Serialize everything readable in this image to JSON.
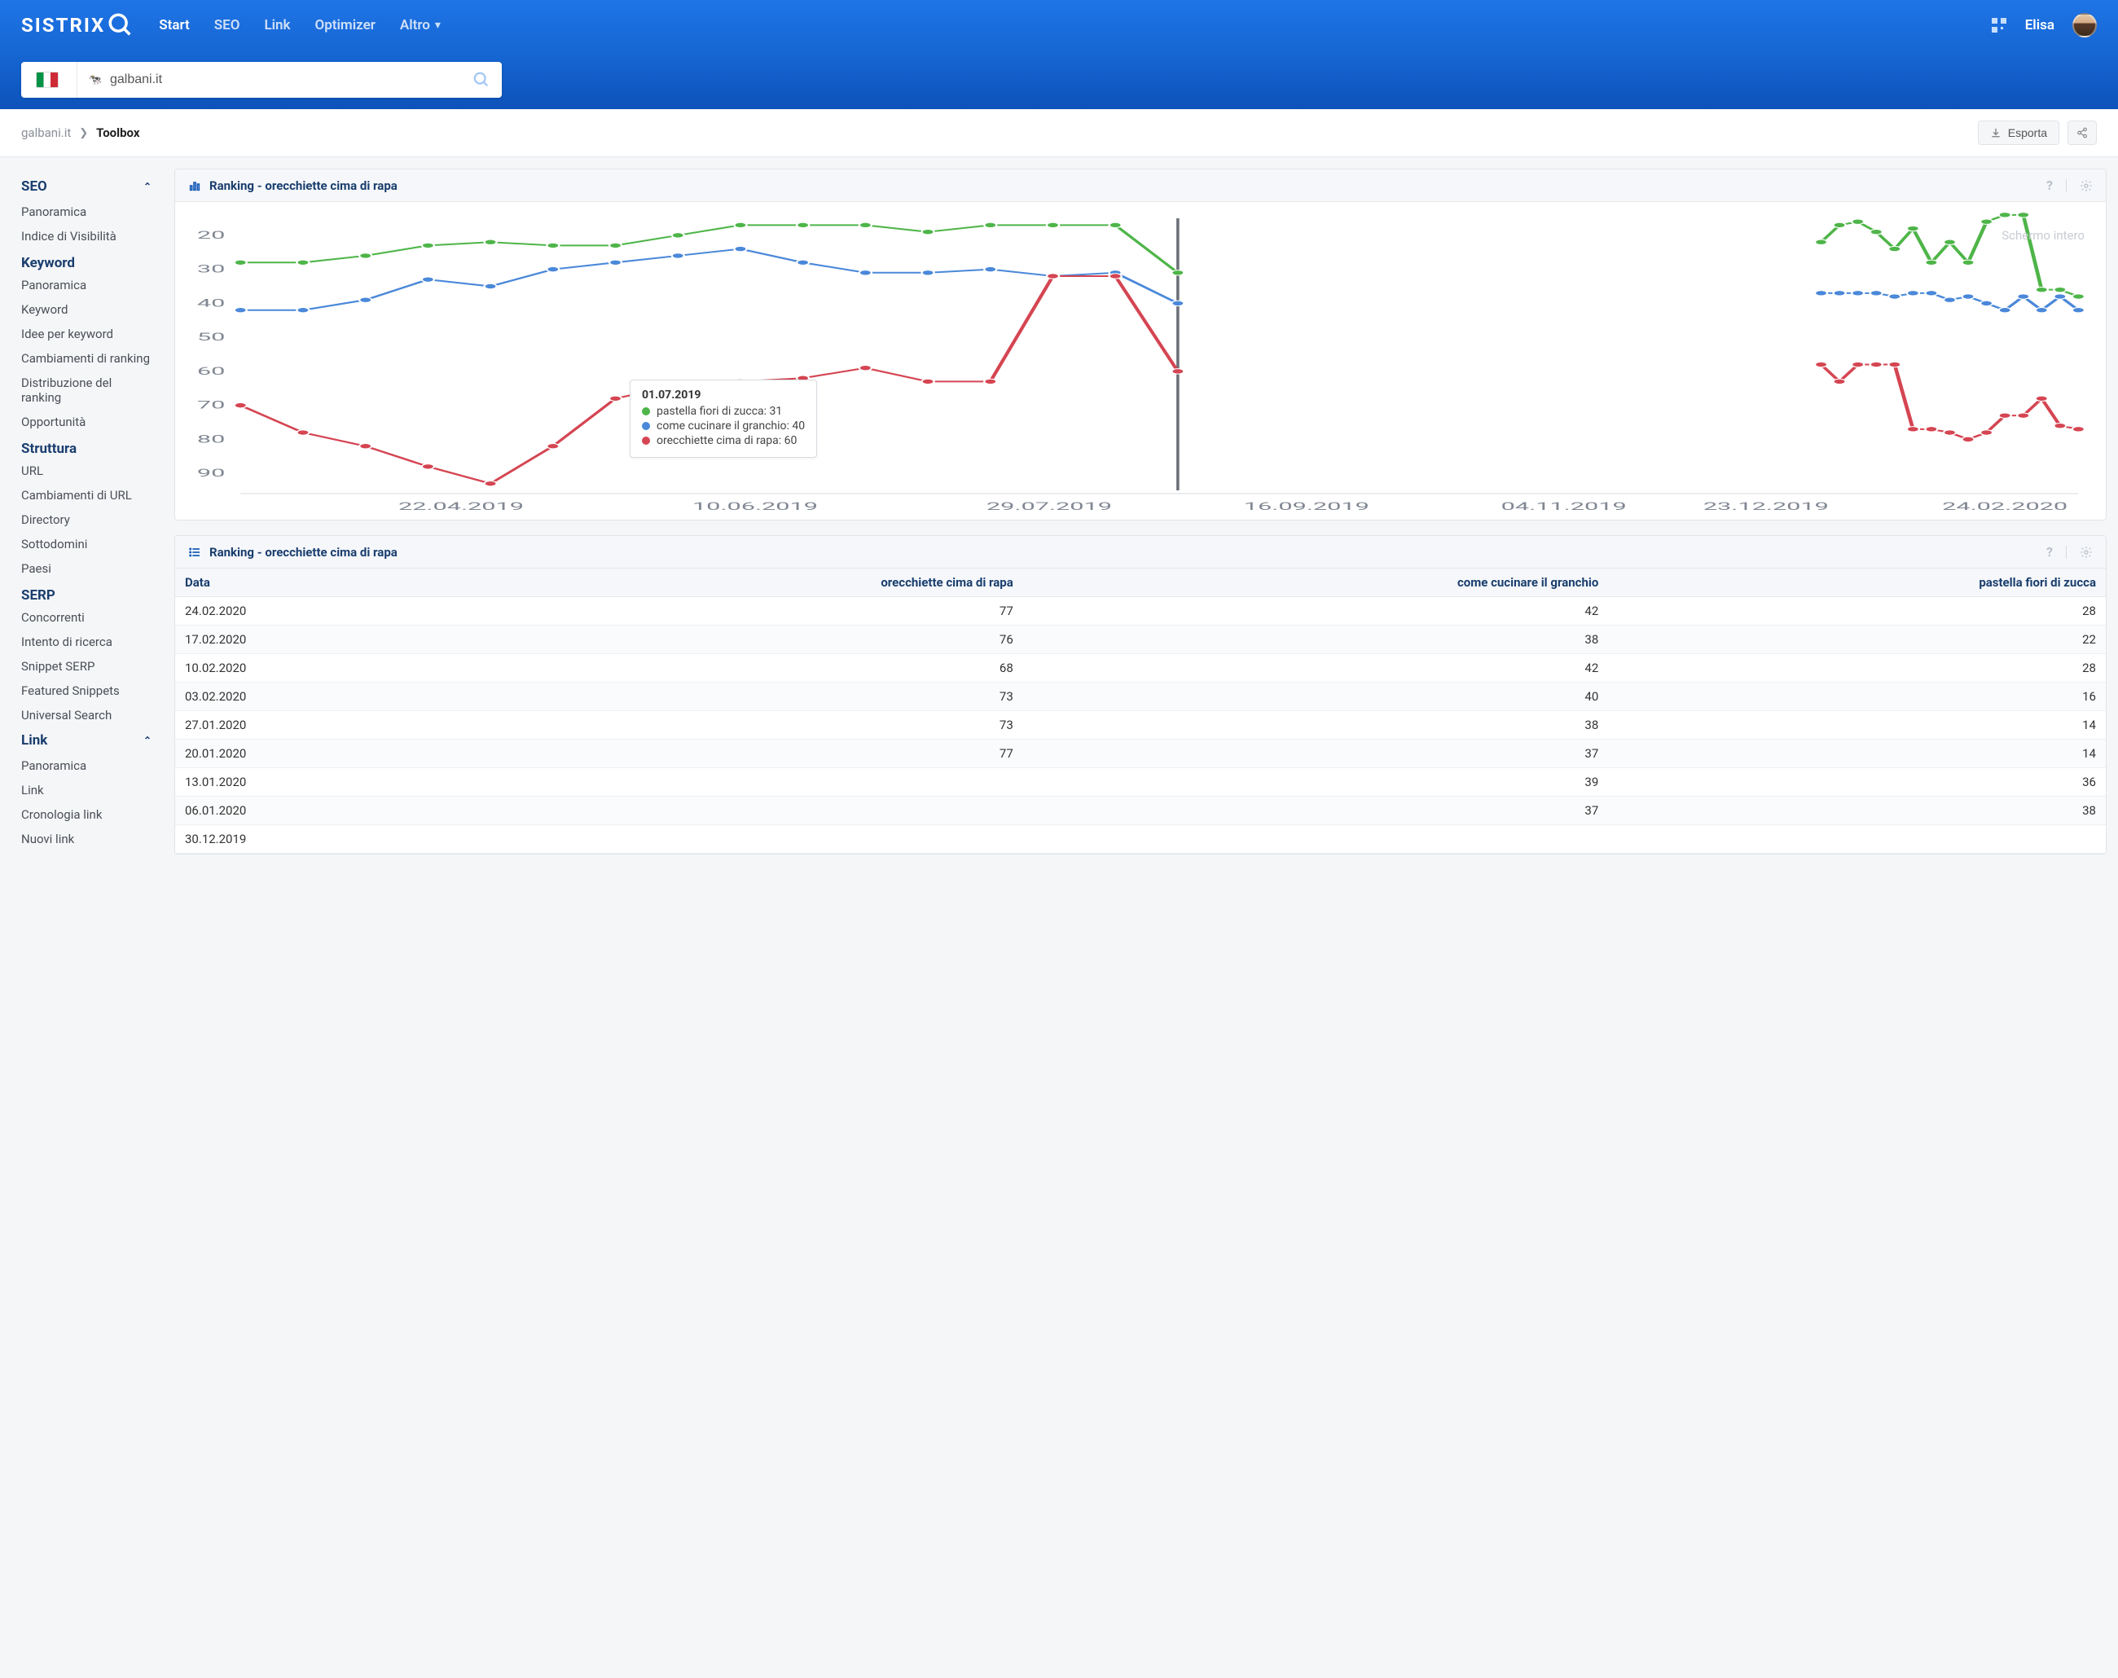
{
  "nav": {
    "brand": "SISTRIX",
    "items": [
      "Start",
      "SEO",
      "Link",
      "Optimizer",
      "Altro"
    ],
    "active": 0,
    "user": "Elisa"
  },
  "search": {
    "value": "galbani.it"
  },
  "breadcrumb": {
    "root": "galbani.it",
    "current": "Toolbox",
    "export": "Esporta"
  },
  "sidebar": {
    "sections": [
      {
        "title": "SEO",
        "collapsible": true,
        "groups": [
          {
            "items": [
              "Panoramica",
              "Indice di Visibilità"
            ]
          },
          {
            "heading": "Keyword",
            "items": [
              "Panoramica",
              "Keyword",
              "Idee per keyword",
              "Cambiamenti di ranking",
              "Distribuzione del ranking",
              "Opportunità"
            ]
          },
          {
            "heading": "Struttura",
            "items": [
              "URL",
              "Cambiamenti di URL",
              "Directory",
              "Sottodomini",
              "Paesi"
            ]
          },
          {
            "heading": "SERP",
            "items": [
              "Concorrenti",
              "Intento di ricerca",
              "Snippet SERP",
              "Featured Snippets",
              "Universal Search"
            ]
          }
        ]
      },
      {
        "title": "Link",
        "collapsible": true,
        "groups": [
          {
            "items": [
              "Panoramica",
              "Link",
              "Cronologia link",
              "Nuovi link"
            ]
          }
        ]
      }
    ]
  },
  "chart": {
    "title": "Ranking - orecchiette cima di rapa",
    "fullscreen_label": "Schermo intero",
    "tooltip": {
      "date": "01.07.2019",
      "rows": [
        {
          "label": "pastella fiori di zucca",
          "value": 31,
          "color": "#4eb548"
        },
        {
          "label": "come cucinare il granchio",
          "value": 40,
          "color": "#4a88d9"
        },
        {
          "label": "orecchiette cima di rapa",
          "value": 60,
          "color": "#d54552"
        }
      ]
    }
  },
  "chart_data": {
    "type": "line",
    "ylabel": "",
    "xlabel": "",
    "ylim": [
      95,
      15
    ],
    "x_ticks": [
      "22.04.2019",
      "10.06.2019",
      "29.07.2019",
      "16.09.2019",
      "04.11.2019",
      "23.12.2019",
      "24.02.2020"
    ],
    "y_ticks": [
      20,
      30,
      40,
      50,
      60,
      70,
      80,
      90
    ],
    "hover_index": 15,
    "break_after_index": 15,
    "break_span_weeks": 30,
    "series": [
      {
        "name": "pastella fiori di zucca",
        "color": "#4eb548",
        "values": [
          28,
          28,
          26,
          23,
          22,
          23,
          23,
          20,
          17,
          17,
          17,
          19,
          17,
          17,
          17,
          31,
          22,
          17,
          16,
          19,
          24,
          18,
          28,
          22,
          28,
          16,
          14,
          14,
          36,
          36,
          38
        ]
      },
      {
        "name": "come cucinare il granchio",
        "color": "#4a88d9",
        "values": [
          42,
          42,
          39,
          33,
          35,
          30,
          28,
          26,
          24,
          28,
          31,
          31,
          30,
          32,
          31,
          40,
          37,
          37,
          37,
          37,
          38,
          37,
          37,
          39,
          38,
          40,
          42,
          38,
          42,
          38,
          42
        ]
      },
      {
        "name": "orecchiette cima di rapa",
        "color": "#d54552",
        "values": [
          70,
          78,
          82,
          88,
          93,
          82,
          68,
          64,
          63,
          62,
          59,
          63,
          63,
          32,
          32,
          60,
          58,
          63,
          58,
          58,
          58,
          77,
          77,
          78,
          80,
          78,
          73,
          73,
          68,
          76,
          77
        ]
      }
    ]
  },
  "table": {
    "title": "Ranking - orecchiette cima di rapa",
    "columns": [
      "Data",
      "orecchiette cima di rapa",
      "come cucinare il granchio",
      "pastella fiori di zucca"
    ],
    "rows": [
      [
        "24.02.2020",
        "77",
        "42",
        "28"
      ],
      [
        "17.02.2020",
        "76",
        "38",
        "22"
      ],
      [
        "10.02.2020",
        "68",
        "42",
        "28"
      ],
      [
        "03.02.2020",
        "73",
        "40",
        "16"
      ],
      [
        "27.01.2020",
        "73",
        "38",
        "14"
      ],
      [
        "20.01.2020",
        "77",
        "37",
        "14"
      ],
      [
        "13.01.2020",
        "",
        "39",
        "36"
      ],
      [
        "06.01.2020",
        "",
        "37",
        "38"
      ],
      [
        "30.12.2019",
        "",
        "",
        ""
      ]
    ]
  }
}
